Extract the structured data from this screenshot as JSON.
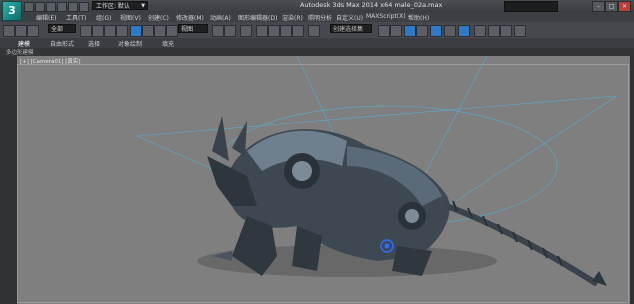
{
  "app": {
    "logo_text": "3",
    "window_title": "Autodesk 3ds Max  2014 x64      male_02a.max",
    "workspace": "工作区: 默认"
  },
  "menus": [
    "编辑(E)",
    "工具(T)",
    "组(G)",
    "视图(V)",
    "创建(C)",
    "修改器(M)",
    "动画(A)",
    "图形编辑器(D)",
    "渲染(R)",
    "照明分析",
    "自定义(U)",
    "MAXScript(X)",
    "帮助(H)"
  ],
  "toolbar": {
    "selection_filter": "全部",
    "ref_coord": "视图",
    "named_selection": "创建选择集"
  },
  "ribbon": {
    "tabs": [
      "建模",
      "自由形式",
      "选择",
      "对象绘制",
      "填充"
    ],
    "active_tab": "建模",
    "sub_label": "多边形建模"
  },
  "viewport": {
    "label": "[+] [Camera01] [真实]"
  },
  "colors": {
    "accent": "#2f79c9",
    "viewport_bg": "#7f7f7f",
    "chrome": "#45484c"
  }
}
